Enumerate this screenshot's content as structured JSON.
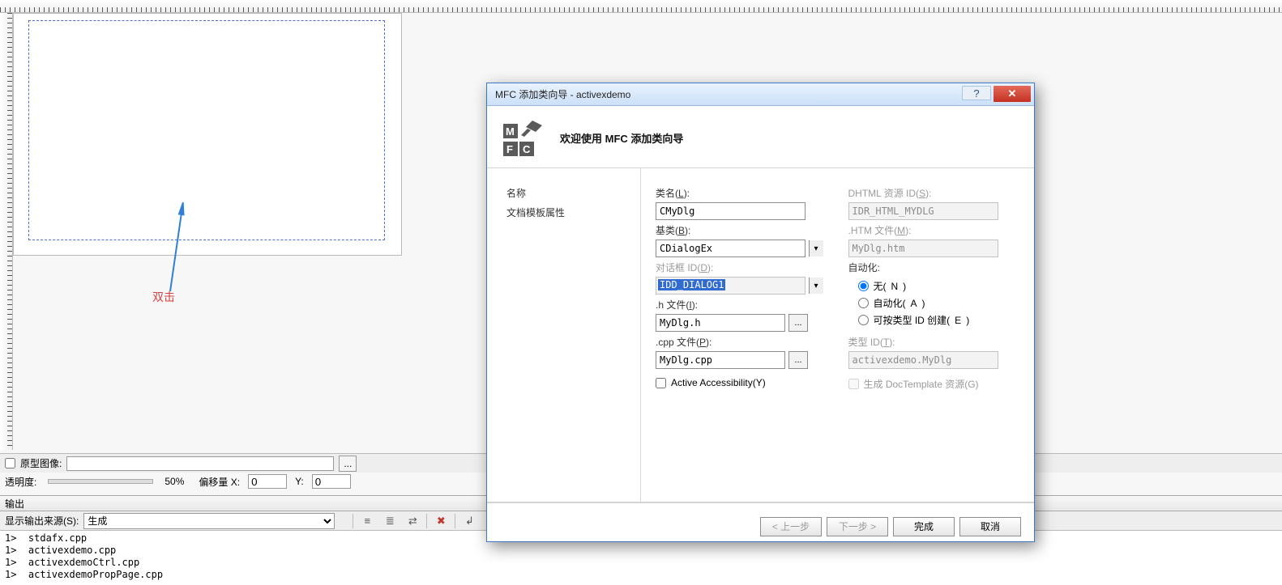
{
  "annotation": {
    "double_click": "双击"
  },
  "status1": {
    "orig_label": "原型图像:",
    "transparency_label": "透明度:",
    "percent": "50%",
    "offset_x_label": "偏移量 X:",
    "offset_x": "0",
    "offset_y_label": "Y:",
    "offset_y": "0"
  },
  "output": {
    "title": "输出",
    "source_label": "显示输出来源(S):",
    "source_value": "生成",
    "lines": [
      "1>  stdafx.cpp",
      "1>  activexdemo.cpp",
      "1>  activexdemoCtrl.cpp",
      "1>  activexdemoPropPage.cpp"
    ]
  },
  "wizard": {
    "title": "MFC 添加类向导 - activexdemo",
    "banner": "欢迎使用  MFC  添加类向导",
    "nav": {
      "item1": "名称",
      "item2": "文档模板属性"
    },
    "labels": {
      "class_name": "类名(L):",
      "class_name_mn": "L",
      "base_class": "基类(B):",
      "base_class_mn": "B",
      "dialog_id": "对话框 ID(D):",
      "dialog_id_mn": "D",
      "h_file": ".h 文件(I):",
      "h_file_mn": "I",
      "cpp_file": ".cpp 文件(P):",
      "cpp_file_mn": "P",
      "active_acc": "Active Accessibility(Y)",
      "active_acc_mn": "Y",
      "dhtml": "DHTML 资源 ID(S):",
      "dhtml_mn": "S",
      "htm": ".HTM 文件(M):",
      "htm_mn": "M",
      "automation": "自动化:",
      "r_none": "无(N)",
      "r_none_mn": "N",
      "r_auto": "自动化(A)",
      "r_auto_mn": "A",
      "r_typeid": "可按类型 ID 创建(E)",
      "r_typeid_mn": "E",
      "type_id": "类型 ID(T):",
      "type_id_mn": "T",
      "doctemplate": "生成 DocTemplate 资源(G)",
      "doctemplate_mn": "G"
    },
    "values": {
      "class_name": "CMyDlg",
      "base_class": "CDialogEx",
      "dialog_id": "IDD_DIALOG1",
      "h_file": "MyDlg.h",
      "cpp_file": "MyDlg.cpp",
      "dhtml": "IDR_HTML_MYDLG",
      "htm": "MyDlg.htm",
      "type_id": "activexdemo.MyDlg"
    },
    "buttons": {
      "prev": "< 上一步",
      "next": "下一步 >",
      "finish": "完成",
      "cancel": "取消"
    }
  }
}
